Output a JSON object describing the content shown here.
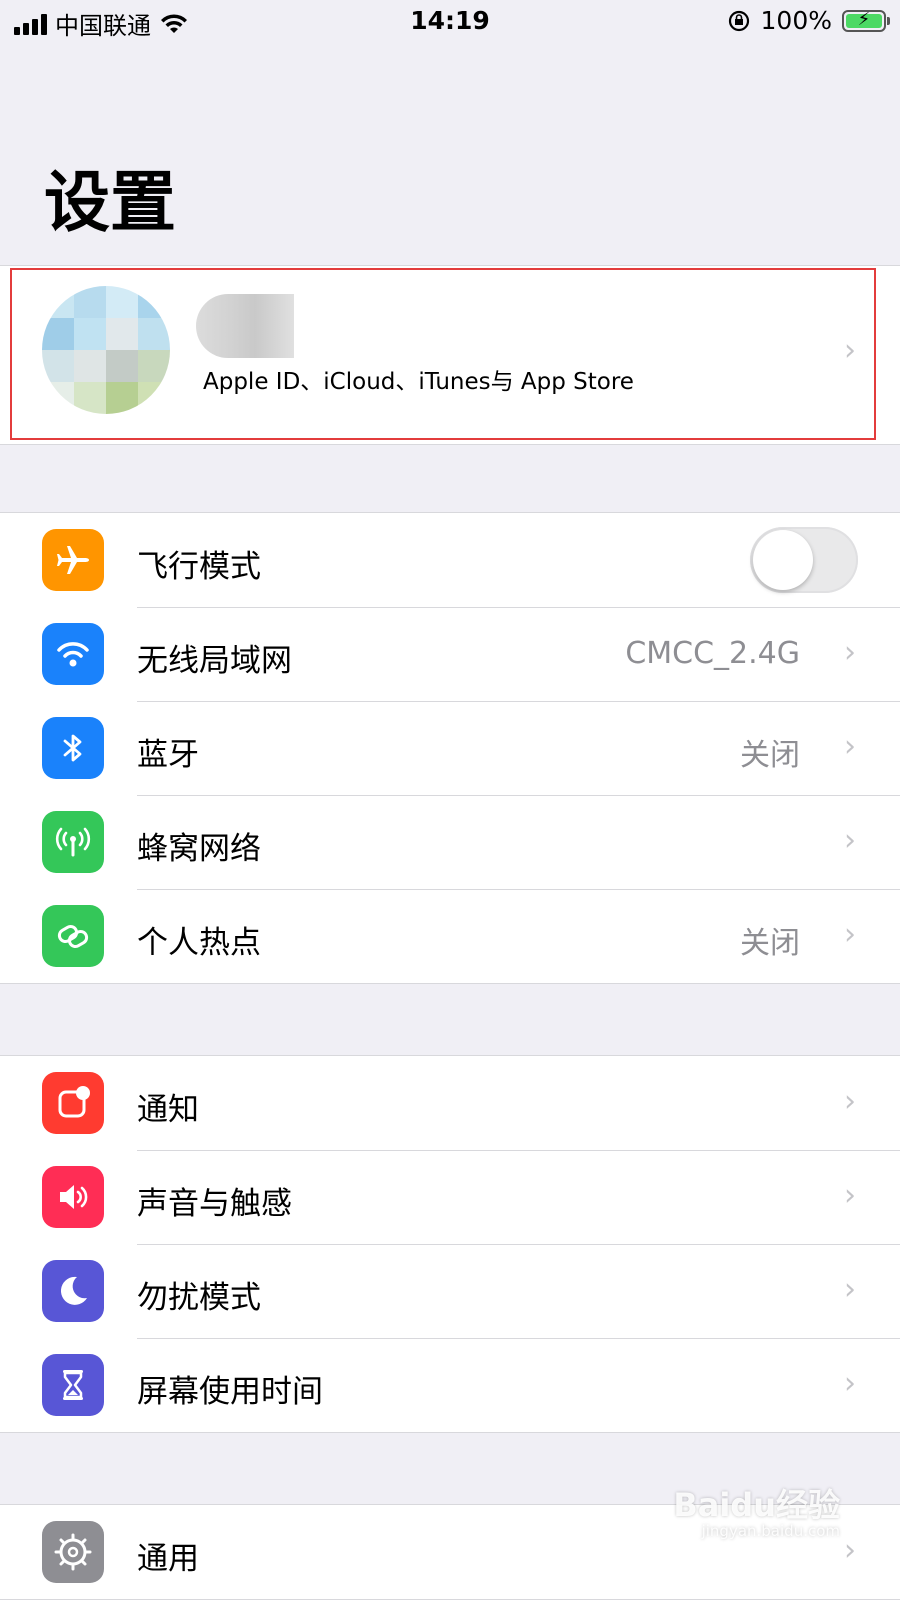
{
  "status_bar": {
    "carrier": "中国联通",
    "time": "14:19",
    "battery_percent": "100%",
    "battery_level": 1.0,
    "icons": [
      "signal-icon",
      "wifi-icon",
      "orientation-lock-icon",
      "battery-charging-icon"
    ]
  },
  "page": {
    "title": "设置"
  },
  "apple_id": {
    "subtitle": "Apple ID、iCloud、iTunes与 App Store",
    "highlight_color": "#e33c3c"
  },
  "groups": [
    {
      "items": [
        {
          "label": "飞行模式",
          "icon": "airplane-icon",
          "color": "#ff9500",
          "toggle": false
        },
        {
          "label": "无线局域网",
          "icon": "wifi-icon",
          "color": "#1a82fb",
          "value": "CMCC_2.4G"
        },
        {
          "label": "蓝牙",
          "icon": "bluetooth-icon",
          "color": "#1a82fb",
          "value": "关闭"
        },
        {
          "label": "蜂窝网络",
          "icon": "antenna-icon",
          "color": "#34c759"
        },
        {
          "label": "个人热点",
          "icon": "hotspot-icon",
          "color": "#34c759",
          "value": "关闭"
        }
      ]
    },
    {
      "items": [
        {
          "label": "通知",
          "icon": "notification-icon",
          "color": "#ff3b30"
        },
        {
          "label": "声音与触感",
          "icon": "speaker-icon",
          "color": "#ff2d55"
        },
        {
          "label": "勿扰模式",
          "icon": "moon-icon",
          "color": "#5856d6"
        },
        {
          "label": "屏幕使用时间",
          "icon": "hourglass-icon",
          "color": "#5856d6"
        }
      ]
    },
    {
      "items": [
        {
          "label": "通用",
          "icon": "gear-icon",
          "color": "#8e8e93"
        }
      ]
    }
  ],
  "watermark": {
    "brand": "Baidu经验",
    "url": "jingyan.baidu.com"
  }
}
